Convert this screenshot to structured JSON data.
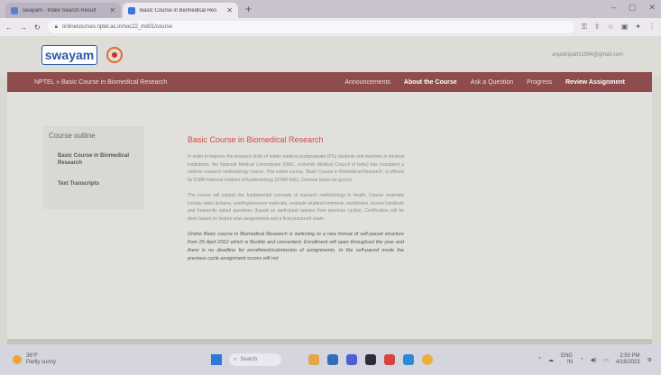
{
  "browser": {
    "tabs": [
      {
        "title": "swayam - Index Search Result",
        "active": false,
        "color": "#5a7fd1"
      },
      {
        "title": "Basic Course in Biomedical Res",
        "active": true,
        "color": "#3a78d8"
      }
    ],
    "url": "onlinecourses.nptel.ac.in/noc22_md01/course"
  },
  "header": {
    "logo_text": "swayam",
    "user_email": "anjalitripathi1994@gmail.com"
  },
  "nav": {
    "breadcrumb_root": "NPTEL",
    "breadcrumb_sep": "»",
    "breadcrumb_course": "Basic Course in Biomedical Research",
    "links": [
      {
        "label": "Announcements",
        "bold": false
      },
      {
        "label": "About the Course",
        "bold": true
      },
      {
        "label": "Ask a Question",
        "bold": false
      },
      {
        "label": "Progress",
        "bold": false
      },
      {
        "label": "Review Assignment",
        "bold": true
      }
    ]
  },
  "sidebar": {
    "title": "Course outline",
    "items": [
      "Basic Course in Biomedical Research",
      "Text Transcripts"
    ]
  },
  "main": {
    "title": "Basic Course in Biomedical Research",
    "para1": "In order to improve the research skills of Indian medical postgraduate (PG) students and teachers in medical institutions, the National Medical Commission (NMC, erstwhile Medical Council of India) has mandated a uniform research methodology course. This online course, 'Basic Course in Biomedical Research', is offered by ICMR-National Institute of Epidemiology (ICMR-NIE), Chennai (www.nie.gov.in).",
    "para2": "The course will explain the fundamental concepts of research methodology in health. Course materials include video lectures, reading/resource materials, example studies/comments, workbooks, lecture handouts and frequently asked questions (based on participant queries from previous cycles). Certification will be done based on lecture wise assignments and a final proctored exam.",
    "para3": "Online Basic course in Biomedical Research is switching to a new format of self-paced structure from 25 April 2022 which is flexible and convenient. Enrollment will open throughout the year and there is no deadline for enrollment/submission of assignments. In the self-paced mode the previous cycle assignment scores will not"
  },
  "taskbar": {
    "weather_temp": "36°F",
    "weather_desc": "Partly sunny",
    "search_label": "Search",
    "lang": "ENG",
    "lang2": "IN",
    "time": "2:50 PM",
    "date": "4/16/2023"
  }
}
